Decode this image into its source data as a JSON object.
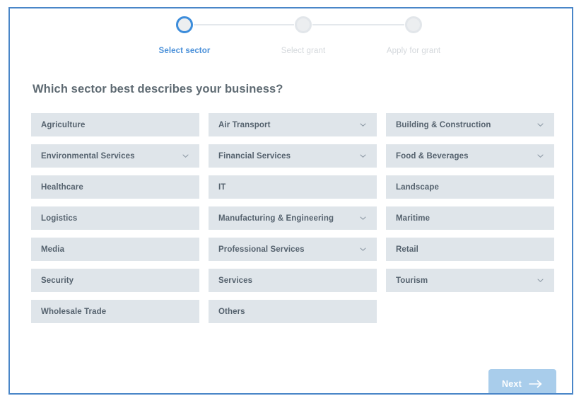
{
  "frame": {
    "border_color": "#4a86c8"
  },
  "stepper": {
    "steps": [
      {
        "label": "Select sector",
        "state": "active"
      },
      {
        "label": "Select grant",
        "state": "inactive"
      },
      {
        "label": "Apply for grant",
        "state": "inactive"
      }
    ],
    "active_color": "#4a90d9",
    "inactive_color": "#d4d8dc",
    "line_color": "#e4e8ec"
  },
  "heading": {
    "text": "Which sector best describes your business?"
  },
  "sectors": {
    "tile_color": "#dfe5ea",
    "label_color": "#55626e",
    "rows": [
      [
        {
          "label": "Agriculture",
          "has_chevron": false
        },
        {
          "label": "Air Transport",
          "has_chevron": true
        },
        {
          "label": "Building & Construction",
          "has_chevron": true
        }
      ],
      [
        {
          "label": "Environmental Services",
          "has_chevron": true
        },
        {
          "label": "Financial Services",
          "has_chevron": true
        },
        {
          "label": "Food & Beverages",
          "has_chevron": true
        }
      ],
      [
        {
          "label": "Healthcare",
          "has_chevron": false
        },
        {
          "label": "IT",
          "has_chevron": false
        },
        {
          "label": "Landscape",
          "has_chevron": false
        }
      ],
      [
        {
          "label": "Logistics",
          "has_chevron": false
        },
        {
          "label": "Manufacturing & Engineering",
          "has_chevron": true
        },
        {
          "label": "Maritime",
          "has_chevron": false
        }
      ],
      [
        {
          "label": "Media",
          "has_chevron": false
        },
        {
          "label": "Professional Services",
          "has_chevron": true
        },
        {
          "label": "Retail",
          "has_chevron": false
        }
      ],
      [
        {
          "label": "Security",
          "has_chevron": false
        },
        {
          "label": "Services",
          "has_chevron": false
        },
        {
          "label": "Tourism",
          "has_chevron": true
        }
      ],
      [
        {
          "label": "Wholesale Trade",
          "has_chevron": false
        },
        {
          "label": "Others",
          "has_chevron": false
        },
        {
          "label": "",
          "has_chevron": false,
          "empty": true
        }
      ]
    ]
  },
  "next_button": {
    "label": "Next",
    "icon": "arrow-right-icon",
    "background": "#a9cdeb",
    "text_color": "#ffffff"
  }
}
